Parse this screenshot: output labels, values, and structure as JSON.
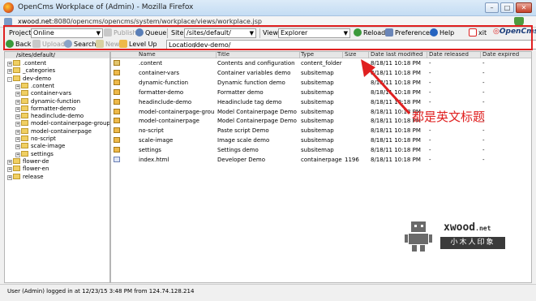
{
  "window": {
    "title": "OpenCms Workplace of (Admin) - Mozilla Firefox",
    "controls": {
      "minimize": "–",
      "maximize": "□",
      "close": "✕"
    }
  },
  "address": {
    "url_host": "xwood.net",
    "url_rest": ":8080/opencms/opencms/system/workplace/views/workplace.jsp"
  },
  "toolbar": {
    "project_label": "Project",
    "project_value": "Online",
    "publish_label": "Publish",
    "queue_label": "Queue",
    "site_label": "Site",
    "site_value": "/sites/default/",
    "view_label": "View",
    "view_value": "Explorer",
    "reload_label": "Reload",
    "preferences_label": "Preferences",
    "help_label": "Help",
    "exit_label": "xit",
    "logo_text": "OpenCms",
    "back_label": "Back",
    "upload_label": "Upload",
    "search_label": "Search",
    "new_label": "New",
    "levelup_label": "Level Up",
    "location_label": "Location",
    "location_value": "/dev-demo/"
  },
  "tree": {
    "root": "/sites/default/",
    "nodes": [
      {
        "label": ".content",
        "level": 1,
        "pm": "+"
      },
      {
        "label": "_categories",
        "level": 1,
        "pm": "+"
      },
      {
        "label": "dev-demo",
        "level": 1,
        "pm": "-"
      },
      {
        "label": ".content",
        "level": 2,
        "pm": "+"
      },
      {
        "label": "container-vars",
        "level": 2,
        "pm": "+"
      },
      {
        "label": "dynamic-function",
        "level": 2,
        "pm": "+"
      },
      {
        "label": "formatter-demo",
        "level": 2,
        "pm": "+"
      },
      {
        "label": "headinclude-demo",
        "level": 2,
        "pm": "+"
      },
      {
        "label": "model-containerpage-group",
        "level": 2,
        "pm": "+"
      },
      {
        "label": "model-containerpage",
        "level": 2,
        "pm": "+"
      },
      {
        "label": "no-script",
        "level": 2,
        "pm": "+"
      },
      {
        "label": "scale-image",
        "level": 2,
        "pm": "+"
      },
      {
        "label": "settings",
        "level": 2,
        "pm": "+"
      },
      {
        "label": "flower-de",
        "level": 1,
        "pm": "+"
      },
      {
        "label": "flower-en",
        "level": 1,
        "pm": "+"
      },
      {
        "label": "release",
        "level": 1,
        "pm": "+"
      }
    ]
  },
  "grid": {
    "columns": [
      "Name",
      "Title",
      "Type",
      "Size",
      "Date last modified",
      "Date released",
      "Date expired"
    ],
    "rows": [
      {
        "name": ".content",
        "title": "Contents and configuration",
        "type": "content_folder",
        "size": "",
        "modified": "8/18/11 10:18 PM",
        "released": "-",
        "expired": "-",
        "icon": "sel"
      },
      {
        "name": "container-vars",
        "title": "Container variables demo",
        "type": "subsitemap",
        "size": "",
        "modified": "8/18/11 10:18 PM",
        "released": "-",
        "expired": "-",
        "icon": "folder"
      },
      {
        "name": "dynamic-function",
        "title": "Dynamic function demo",
        "type": "subsitemap",
        "size": "",
        "modified": "8/18/11 10:18 PM",
        "released": "-",
        "expired": "-",
        "icon": "folder"
      },
      {
        "name": "formatter-demo",
        "title": "Formatter demo",
        "type": "subsitemap",
        "size": "",
        "modified": "8/18/11 10:18 PM",
        "released": "-",
        "expired": "-",
        "icon": "folder"
      },
      {
        "name": "headinclude-demo",
        "title": "Headinclude tag demo",
        "type": "subsitemap",
        "size": "",
        "modified": "8/18/11 10:18 PM",
        "released": "-",
        "expired": "-",
        "icon": "folder"
      },
      {
        "name": "model-containerpage-group",
        "title": "Model Containerpage Demo II",
        "type": "subsitemap",
        "size": "",
        "modified": "8/18/11 10:18 PM",
        "released": "-",
        "expired": "-",
        "icon": "folder"
      },
      {
        "name": "model-containerpage",
        "title": "Model Containerpage Demo I",
        "type": "subsitemap",
        "size": "",
        "modified": "8/18/11 10:18 PM",
        "released": "-",
        "expired": "-",
        "icon": "folder"
      },
      {
        "name": "no-script",
        "title": "Paste script Demo",
        "type": "subsitemap",
        "size": "",
        "modified": "8/18/11 10:18 PM",
        "released": "-",
        "expired": "-",
        "icon": "folder"
      },
      {
        "name": "scale-image",
        "title": "Image scale demo",
        "type": "subsitemap",
        "size": "",
        "modified": "8/18/11 10:18 PM",
        "released": "-",
        "expired": "-",
        "icon": "folder"
      },
      {
        "name": "settings",
        "title": "Settings demo",
        "type": "subsitemap",
        "size": "",
        "modified": "8/18/11 10:18 PM",
        "released": "-",
        "expired": "-",
        "icon": "folder"
      },
      {
        "name": "index.html",
        "title": "Developer Demo",
        "type": "containerpage",
        "size": "1196",
        "modified": "8/18/11 10:18 PM",
        "released": "-",
        "expired": "-",
        "icon": "page"
      }
    ]
  },
  "status": {
    "text": "User (Admin) logged in at 12/23/15 3:48 PM from 124.74.128.214"
  },
  "annotation": {
    "text": "都是英文标题",
    "color": "#e02020"
  },
  "watermark": {
    "brand": "xwood",
    "suffix": ".net",
    "tagline": "小木人印象"
  },
  "colors": {
    "highlight": "#e02020",
    "folder": "#eeb94a",
    "logo": "#1c3d7a"
  }
}
